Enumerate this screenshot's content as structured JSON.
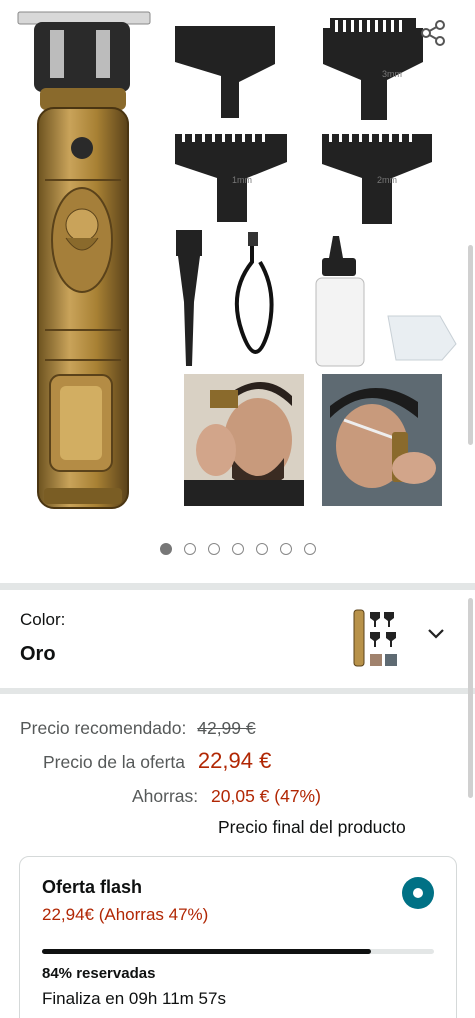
{
  "gallery": {
    "image_count": 7,
    "active_index": 0,
    "accessories": {
      "comb_labels": [
        "3mm",
        "1mm",
        "2mm"
      ]
    }
  },
  "icons": {
    "share": "share-icon",
    "chevron": "chevron-down-icon",
    "radio": "radio-selected-icon"
  },
  "color_selector": {
    "label": "Color:",
    "value": "Oro"
  },
  "price": {
    "list_label": "Precio recomendado:",
    "list_value": "42,99 €",
    "deal_label": "Precio de la oferta",
    "deal_value": "22,94 €",
    "savings_label": "Ahorras:",
    "savings_value": "20,05 € (47%)",
    "final_note": "Precio final del producto"
  },
  "flash_deal": {
    "title": "Oferta flash",
    "price_text": "22,94€ (Ahorras 47%)",
    "claimed_fraction": 0.84,
    "claimed_text": "84% reservadas",
    "ends_text": "Finaliza en 09h 11m 57s"
  },
  "colors": {
    "accent_red": "#b12704",
    "teal": "#007185",
    "gold": "#b8924a",
    "text": "#0f1111",
    "muted": "#565959"
  }
}
